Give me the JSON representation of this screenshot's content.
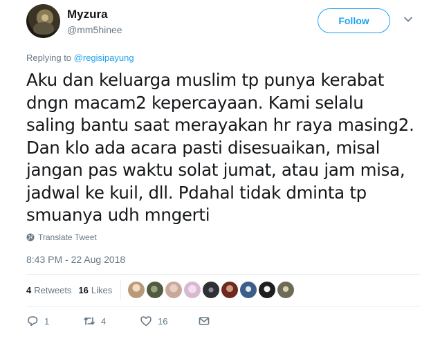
{
  "user": {
    "display_name": "Myzura",
    "handle": "@mm5hinee",
    "avatar_icon": "avatar-image"
  },
  "follow_label": "Follow",
  "replying": {
    "prefix": "Replying to",
    "mention": "@regisipayung"
  },
  "tweet": {
    "lines": [
      "Aku dan keluarga muslim tp punya kerabat",
      "dngn macam2 kepercayaan. Kami selalu",
      "saling bantu saat merayakan hr raya masing2.",
      "Dan klo ada acara pasti disesuaikan, misal",
      "jangan pas waktu solat jumat, atau jam misa,",
      "jadwal ke kuil, dll. Pdahal tidak dminta tp",
      "smuanya udh mngerti"
    ]
  },
  "translate_label": "Translate Tweet",
  "timestamp": "8:43 PM - 22 Aug 2018",
  "stats": {
    "retweets_count": "4",
    "retweets_label": "Retweets",
    "likes_count": "16",
    "likes_label": "Likes"
  },
  "liker_avatars": [
    {
      "color": "#b89a7a"
    },
    {
      "color": "#4f5b3e"
    },
    {
      "color": "#c7a89a"
    },
    {
      "color": "#d8b8d2"
    },
    {
      "color": "#2f2f36"
    },
    {
      "color": "#6e2a20"
    },
    {
      "color": "#3b5f8a"
    },
    {
      "color": "#1e1e1e"
    },
    {
      "color": "#6d6a55"
    }
  ],
  "actions": {
    "reply_count": "1",
    "retweet_count": "4",
    "like_count": "16"
  },
  "colors": {
    "accent": "#1da1f2",
    "secondary_text": "#657786",
    "primary_text": "#14171a",
    "divider": "#e6ecf0"
  }
}
